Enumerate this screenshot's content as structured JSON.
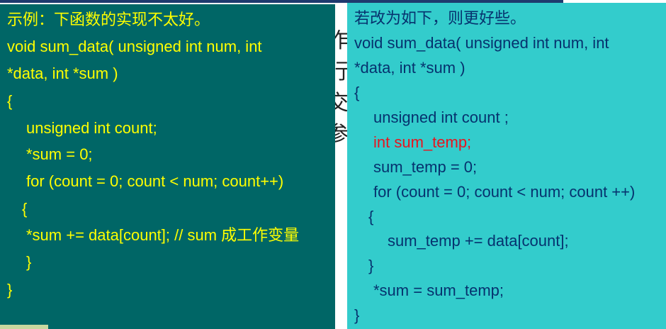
{
  "background_text": [
    "作",
    "行",
    "交",
    "参"
  ],
  "left_code": {
    "lines": [
      "示例：下函数的实现不太好。",
      "void sum_data( unsigned int num, int",
      "*data, int *sum )",
      "{",
      "unsigned int count;",
      "*sum = 0;",
      "for (count = 0; count < num; count++)",
      "{",
      "*sum += data[count]; // sum 成工作变量",
      "}",
      "}"
    ]
  },
  "right_code": {
    "lines": [
      "若改为如下，则更好些。",
      "void sum_data( unsigned int num, int",
      "*data, int *sum )",
      "{",
      "unsigned int count ;",
      "int sum_temp;",
      "sum_temp = 0;",
      "for (count = 0; count < num; count ++)",
      "{",
      "sum_temp += data[count];",
      "}",
      "*sum = sum_temp;",
      "}"
    ]
  },
  "colors": {
    "left_panel_bg": "#006666",
    "left_text": "#ffff00",
    "right_panel_bg": "#33cccc",
    "right_text": "#06326e",
    "highlight_red": "#e8141e"
  }
}
